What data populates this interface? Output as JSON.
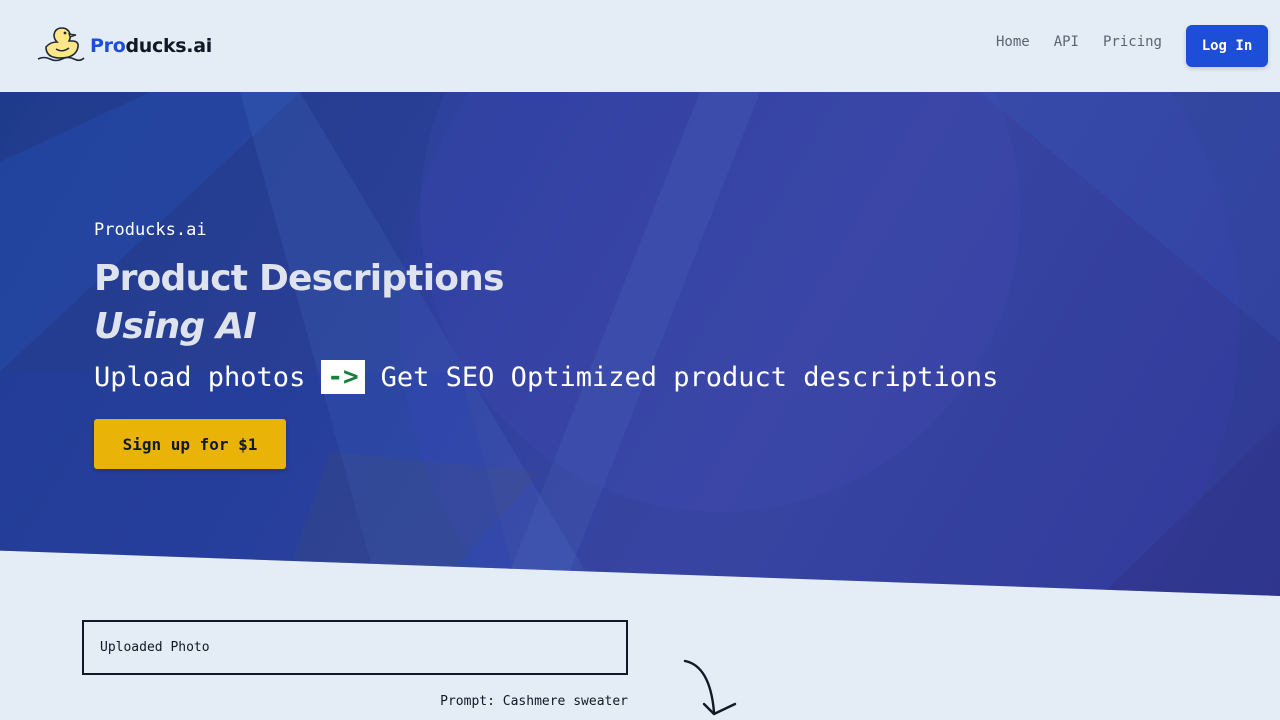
{
  "header": {
    "logo": {
      "prefix": "Pro",
      "suffix": "ducks.ai",
      "icon": "duck-icon"
    },
    "nav": [
      {
        "label": "Home"
      },
      {
        "label": "API"
      },
      {
        "label": "Pricing"
      }
    ],
    "login_label": "Log In"
  },
  "hero": {
    "kicker": "Producks.ai",
    "title_line1": "Product Descriptions",
    "title_line2": "Using AI",
    "subtitle_left": "Upload photos",
    "subtitle_arrow": "->",
    "subtitle_right": "Get SEO Optimized product descriptions",
    "cta_label": "Sign up for $1"
  },
  "demo": {
    "upload_label": "Uploaded Photo",
    "prompt_label": "Prompt: Cashmere sweater",
    "arrow_icon": "curved-arrow-icon"
  },
  "colors": {
    "brand": "#1d4ed8",
    "cta": "#eab308",
    "background": "#e4ecf5",
    "hero": "#2b3f97",
    "arrow_text": "#15803d"
  }
}
